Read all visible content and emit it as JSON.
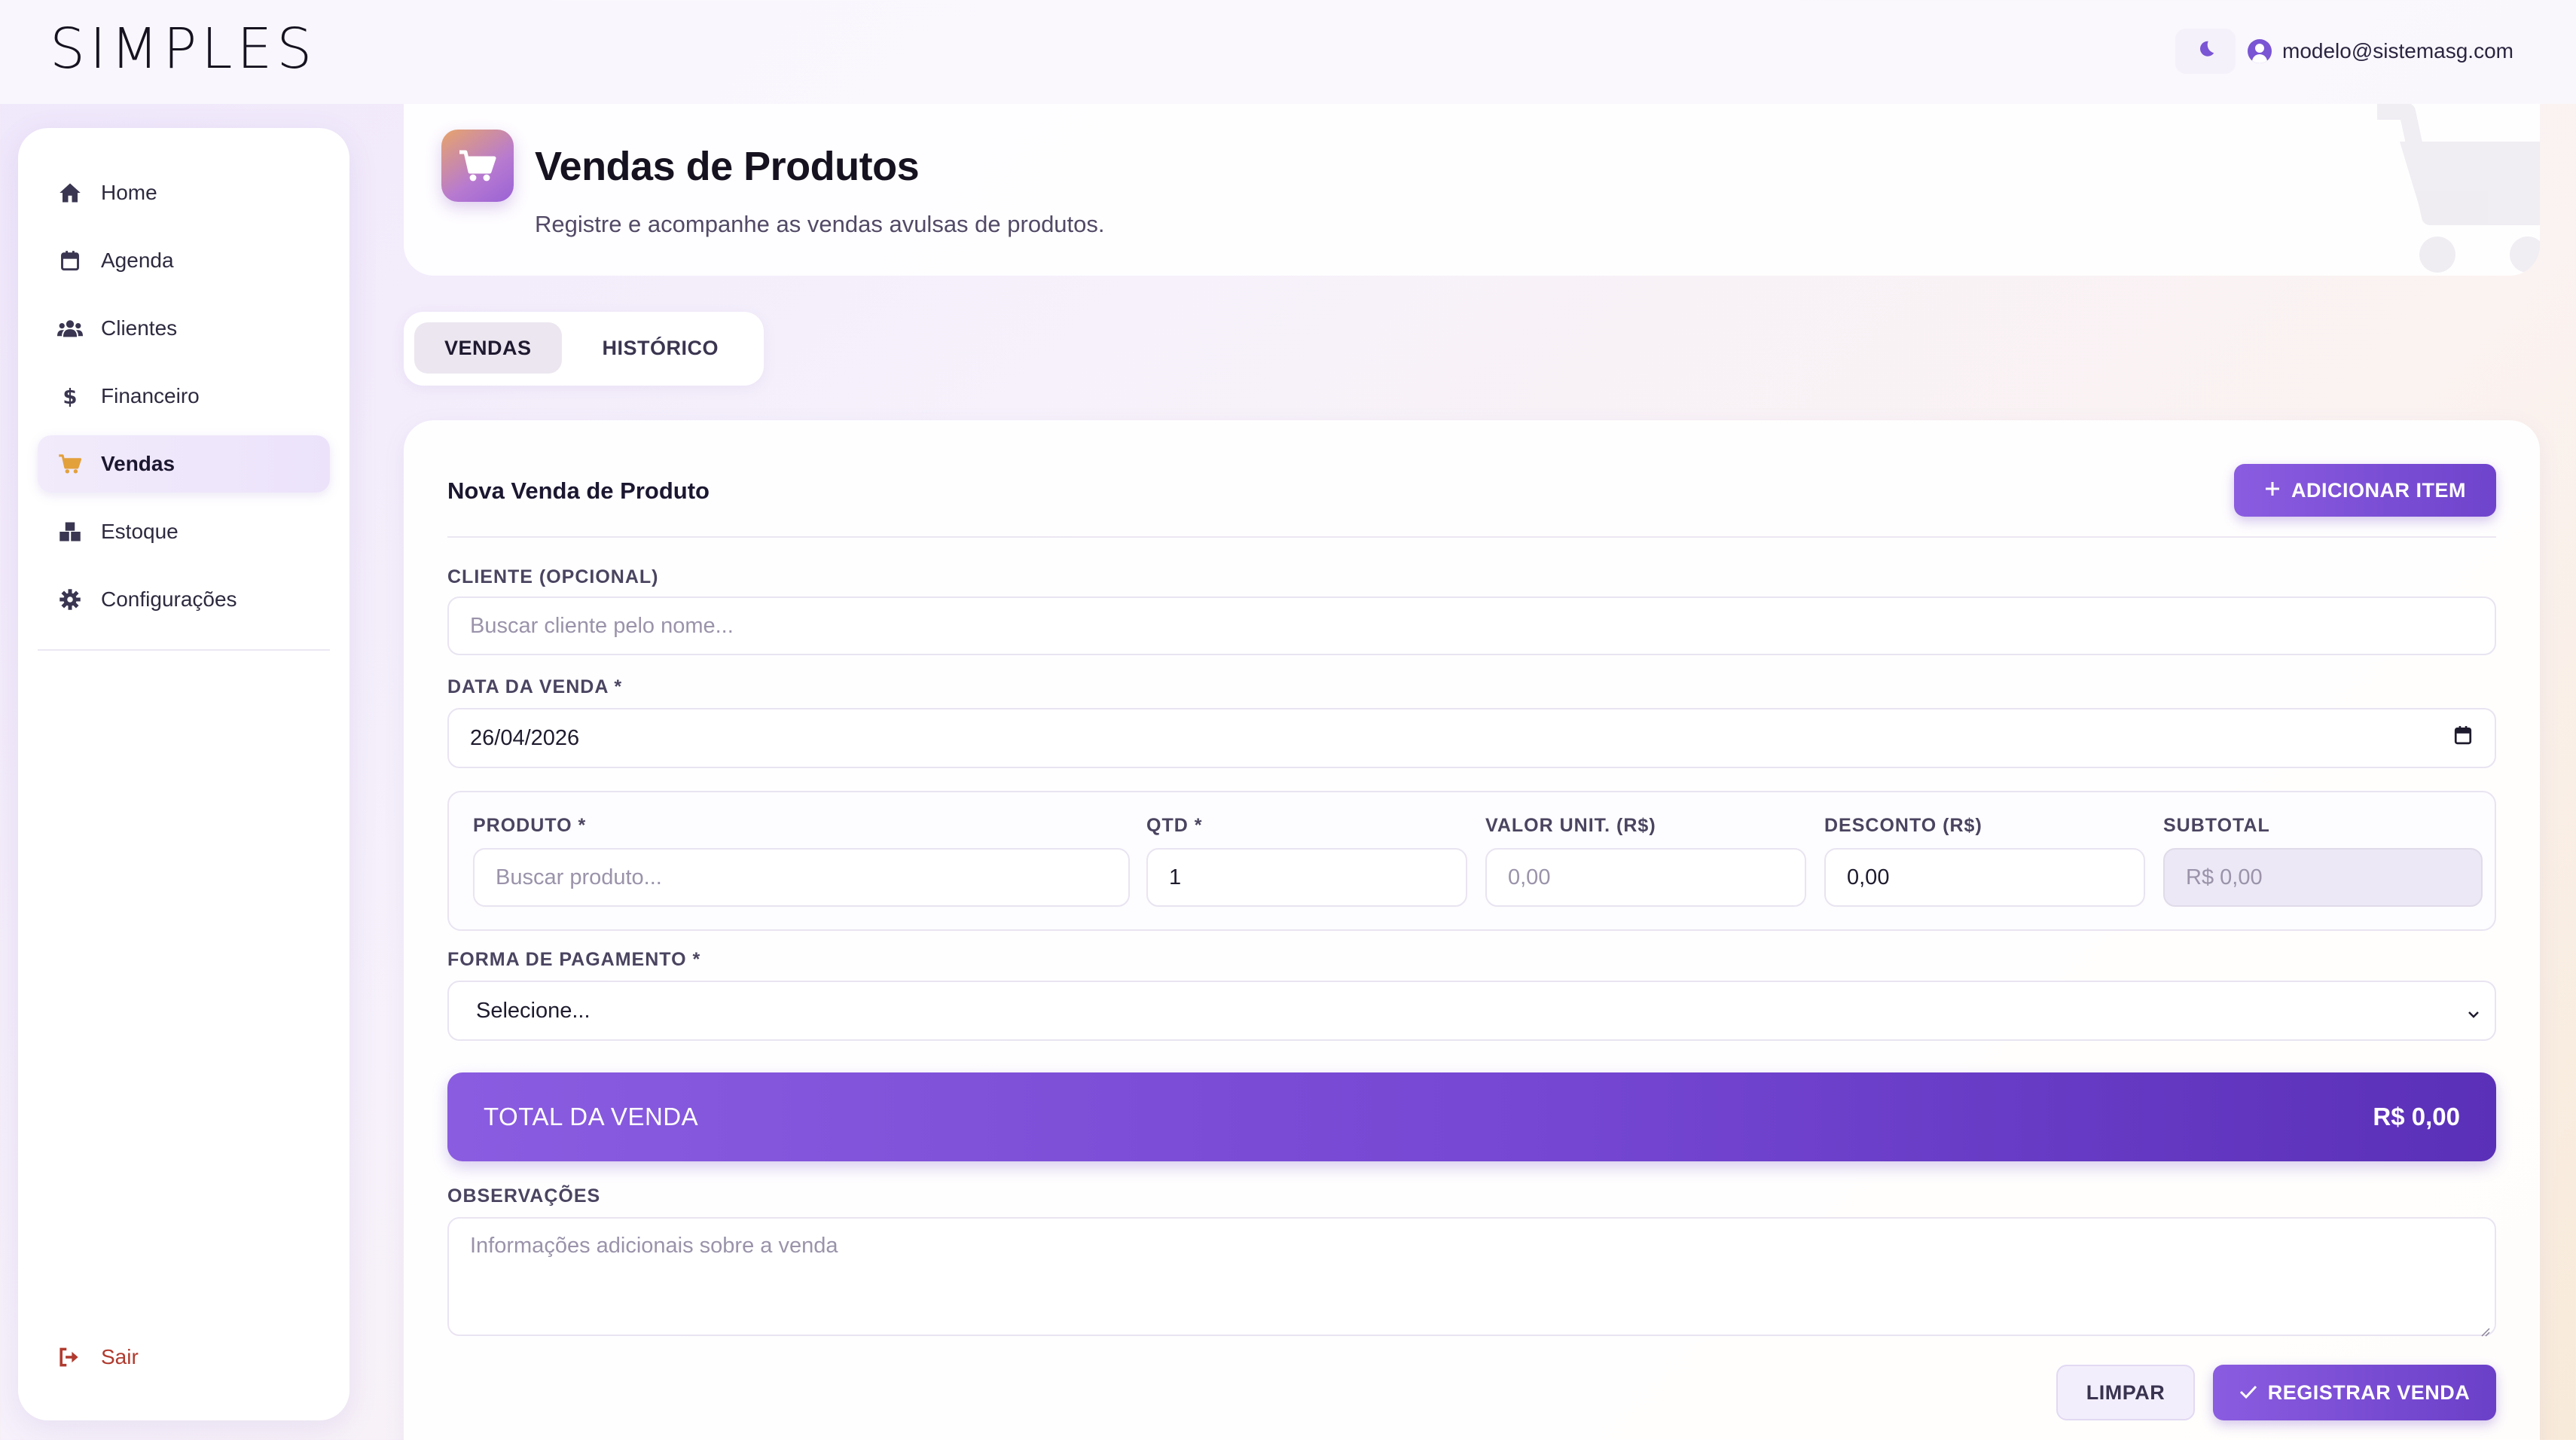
{
  "app": {
    "logo_text": "SIMPLES",
    "user_email": "modelo@sistemasg.com"
  },
  "sidebar": {
    "items": [
      {
        "label": "Home",
        "icon": "home-icon"
      },
      {
        "label": "Agenda",
        "icon": "calendar-icon"
      },
      {
        "label": "Clientes",
        "icon": "users-icon"
      },
      {
        "label": "Financeiro",
        "icon": "dollar-icon"
      },
      {
        "label": "Vendas",
        "icon": "cart-icon",
        "active": true
      },
      {
        "label": "Estoque",
        "icon": "boxes-icon"
      },
      {
        "label": "Configurações",
        "icon": "gear-icon"
      }
    ],
    "logout_label": "Sair"
  },
  "header": {
    "title": "Vendas de Produtos",
    "subtitle": "Registre e acompanhe as vendas avulsas de produtos."
  },
  "tabs": [
    {
      "label": "VENDAS",
      "active": true
    },
    {
      "label": "HISTÓRICO",
      "active": false
    }
  ],
  "form": {
    "title": "Nova Venda de Produto",
    "add_item_label": "ADICIONAR ITEM",
    "cliente": {
      "label": "CLIENTE (OPCIONAL)",
      "placeholder": "Buscar cliente pelo nome..."
    },
    "data": {
      "label": "DATA DA VENDA *",
      "value": "26/04/2026"
    },
    "item": {
      "produto": {
        "label": "PRODUTO *",
        "placeholder": "Buscar produto..."
      },
      "qtd": {
        "label": "QTD *",
        "value": "1"
      },
      "valor_unit": {
        "label": "VALOR UNIT. (R$)",
        "placeholder": "0,00"
      },
      "desconto": {
        "label": "DESCONTO (R$)",
        "value": "0,00"
      },
      "subtotal": {
        "label": "SUBTOTAL",
        "value": "R$ 0,00"
      }
    },
    "pagamento": {
      "label": "FORMA DE PAGAMENTO *",
      "selected": "Selecione..."
    },
    "total": {
      "label": "TOTAL DA VENDA",
      "value": "R$ 0,00"
    },
    "observacoes": {
      "label": "OBSERVAÇÕES",
      "placeholder": "Informações adicionais sobre a venda"
    },
    "clear_label": "LIMPAR",
    "register_label": "REGISTRAR VENDA"
  },
  "colors": {
    "accent": "#7a50d8",
    "accent_dark": "#5b30b8",
    "logout": "#b03a2e",
    "active_icon": "#e3a13c"
  }
}
